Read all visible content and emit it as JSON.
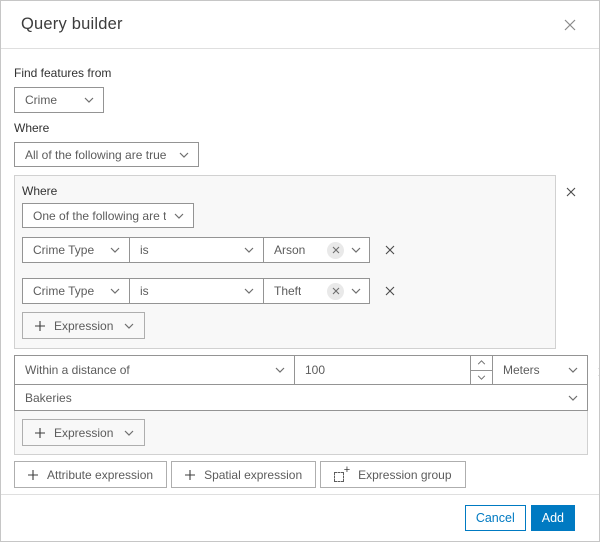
{
  "dialog": {
    "title": "Query builder"
  },
  "icons": {
    "close": "✕",
    "chevron_down": "⌄",
    "plus": "+",
    "clear": "✕",
    "expression_group": "dashed-box-plus"
  },
  "find_features": {
    "label": "Find features from",
    "value": "Crime"
  },
  "where": {
    "label": "Where",
    "combinator": "All of the following are true"
  },
  "group": {
    "label": "Where",
    "combinator": "One of the following are tr...",
    "rows": [
      {
        "field": "Crime Type",
        "operator": "is",
        "value": "Arson"
      },
      {
        "field": "Crime Type",
        "operator": "is",
        "value": "Theft"
      }
    ],
    "add_expression_label": "Expression"
  },
  "spatial": {
    "relation": "Within a distance of",
    "distance": "100",
    "units": "Meters",
    "layer": "Bakeries",
    "add_expression_label": "Expression"
  },
  "actions": {
    "attribute_expression": "Attribute expression",
    "spatial_expression": "Spatial expression",
    "expression_group": "Expression group"
  },
  "footer": {
    "cancel": "Cancel",
    "add": "Add"
  },
  "colors": {
    "accent": "#007ac2",
    "panel_bg": "#f8f8f8",
    "control_border": "#949494"
  }
}
